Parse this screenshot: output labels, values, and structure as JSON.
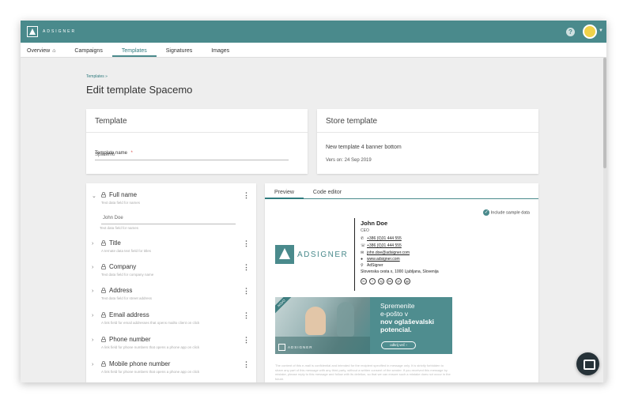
{
  "app": {
    "brand": "ADSIGNER"
  },
  "nav": {
    "tabs": [
      "Overview",
      "Campaigns",
      "Templates",
      "Signatures",
      "Images"
    ],
    "active": "Templates"
  },
  "breadcrumb": "Templates »",
  "page_title": "Edit template Spacemo",
  "template_card": {
    "title": "Template",
    "name_label": "Template name",
    "required_mark": "*",
    "name_value": "Spacemo"
  },
  "store_card": {
    "title": "Store template",
    "template_name": "New template 4 banner bottom",
    "version": "Vers on: 24 Sep 2019"
  },
  "fields": [
    {
      "name": "Full name",
      "hint": "Text data field for names",
      "expanded": true,
      "input_value": "John Doe",
      "input_hint": "Text data field for names"
    },
    {
      "name": "Title",
      "hint": "A ternate data text field for titles"
    },
    {
      "name": "Company",
      "hint": "Text data field for company name"
    },
    {
      "name": "Address",
      "hint": "Text data field for street address"
    },
    {
      "name": "Email address",
      "hint": "A link field for email addresses that opens mailto client on click"
    },
    {
      "name": "Phone number",
      "hint": "A link field for phone numbers that opens a phone app on click"
    },
    {
      "name": "Mobile phone number",
      "hint": "A link field for phone numbers that opens a phone app on click"
    }
  ],
  "preview": {
    "tabs": [
      "Preview",
      "Code editor"
    ],
    "active_tab": "Preview",
    "include_sample": "Include sample data",
    "signature": {
      "company_logo_text": "ADSIGNER",
      "name": "John Doe",
      "role": "CEO",
      "phone": "+386 (0)31 444 555",
      "mobile": "+386 (0)31 444 555",
      "email": "john.doe@adsigner.com",
      "website": "www.adsigner.com",
      "company": "AdSigner",
      "address": "Slovenska cesta x, 1000 Ljubljana, Slovenija",
      "social": [
        "in",
        "f",
        "ig",
        "tw",
        "yt",
        "gp"
      ]
    },
    "banner": {
      "ribbon": "NOVO",
      "line1": "Spremenite",
      "line2": "e-pošto v",
      "line3": "nov oglaševalski",
      "line4": "potencial.",
      "button": "odkrij več",
      "logo_text": "ADSIGNER"
    },
    "disclaimer": "The content of this e-mail is confidential and intended for the recipient specified in message only. It is strictly forbidden to share any part of this message with any third party, without a written consent of the sender. If you received this message by mistake, please reply to this message and follow with its deletion, so that we can ensure such a mistake does not occur in the future."
  },
  "colors": {
    "brand": "#4a8a8c",
    "accent": "#2f7b7e"
  }
}
